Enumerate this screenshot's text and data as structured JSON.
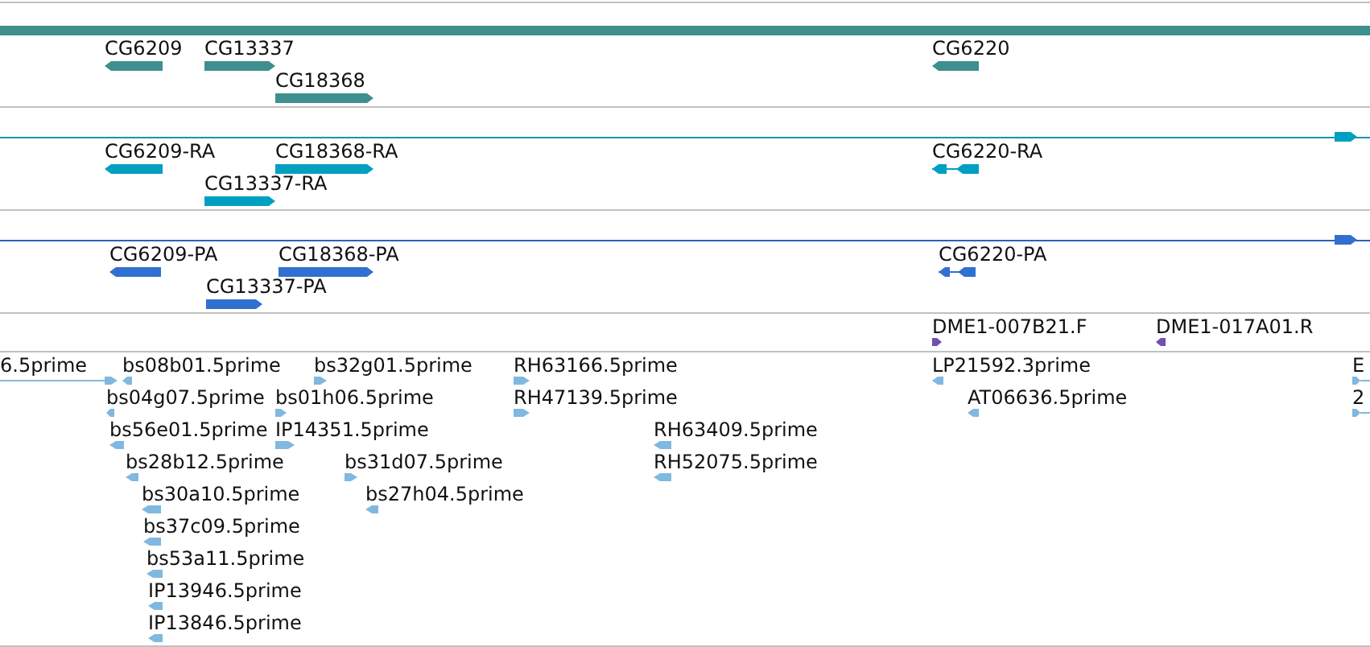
{
  "tracks": [
    {
      "kind": "genes",
      "span_bar": true,
      "features": [
        {
          "label": "CG6209",
          "reverse": true
        },
        {
          "label": "CG13337",
          "reverse": false
        },
        {
          "label": "CG18368",
          "reverse": false
        },
        {
          "label": "CG6220",
          "reverse": true
        }
      ]
    },
    {
      "kind": "transcripts",
      "features": [
        {
          "label": "CG6209-RA",
          "reverse": true
        },
        {
          "label": "CG18368-RA",
          "reverse": false
        },
        {
          "label": "CG13337-RA",
          "reverse": false
        },
        {
          "label": "CG6220-RA",
          "reverse": true,
          "spliced": true
        },
        {
          "reverse": false
        }
      ]
    },
    {
      "kind": "proteins",
      "features": [
        {
          "label": "CG6209-PA",
          "reverse": true
        },
        {
          "label": "CG18368-PA",
          "reverse": false
        },
        {
          "label": "CG13337-PA",
          "reverse": false
        },
        {
          "label": "CG6220-PA",
          "reverse": true,
          "spliced": true
        },
        {
          "reverse": false
        }
      ]
    },
    {
      "kind": "clones",
      "features": [
        {
          "label": "DME1-007B21.F",
          "reverse": false
        },
        {
          "label": "DME1-017A01.R",
          "reverse": true
        }
      ]
    },
    {
      "kind": "ests",
      "features": [
        {
          "label": "6.5prime",
          "reverse": false
        },
        {
          "label": "bs08b01.5prime",
          "reverse": true
        },
        {
          "label": "bs32g01.5prime",
          "reverse": false
        },
        {
          "label": "RH63166.5prime",
          "reverse": false
        },
        {
          "label": "LP21592.3prime",
          "reverse": true
        },
        {
          "label": "E",
          "reverse": false
        },
        {
          "label": "bs04g07.5prime",
          "reverse": true
        },
        {
          "label": "bs01h06.5prime",
          "reverse": false
        },
        {
          "label": "RH47139.5prime",
          "reverse": false
        },
        {
          "label": "AT06636.5prime",
          "reverse": true
        },
        {
          "label": "2",
          "reverse": false
        },
        {
          "label": "bs56e01.5prime",
          "reverse": true
        },
        {
          "label": "IP14351.5prime",
          "reverse": false
        },
        {
          "label": "RH63409.5prime",
          "reverse": true
        },
        {
          "label": "bs28b12.5prime",
          "reverse": true
        },
        {
          "label": "bs31d07.5prime",
          "reverse": false
        },
        {
          "label": "RH52075.5prime",
          "reverse": true
        },
        {
          "label": "bs30a10.5prime",
          "reverse": true
        },
        {
          "label": "bs27h04.5prime",
          "reverse": true
        },
        {
          "label": "bs37c09.5prime",
          "reverse": true
        },
        {
          "label": "bs53a11.5prime",
          "reverse": true
        },
        {
          "label": "IP13946.5prime",
          "reverse": true
        },
        {
          "label": "IP13846.5prime",
          "reverse": true
        }
      ]
    }
  ]
}
